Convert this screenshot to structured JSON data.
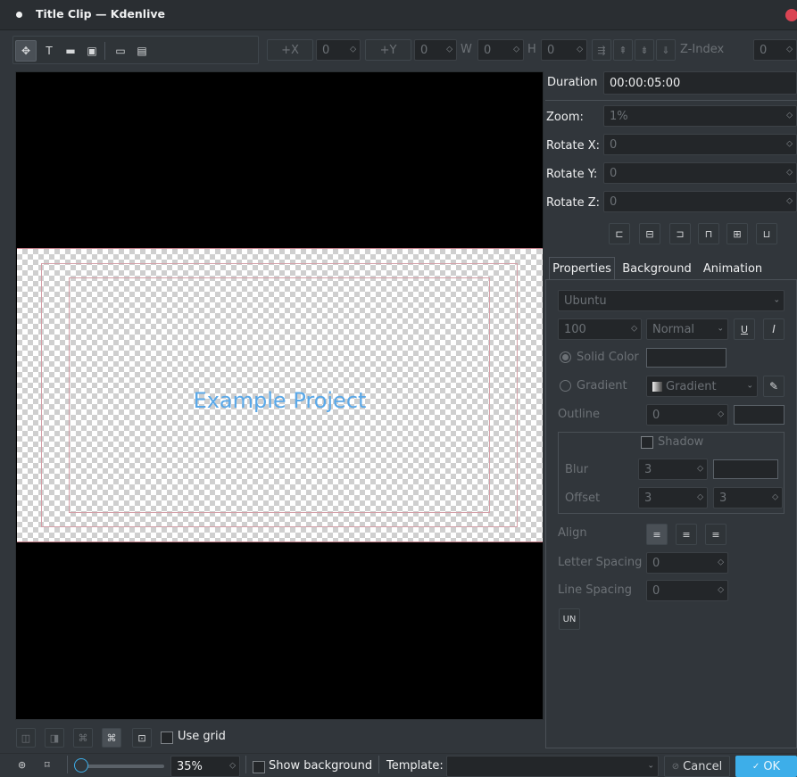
{
  "window": {
    "title": "Title Clip — Kdenlive"
  },
  "toolbar": {
    "tools": [
      "selection-tool",
      "text-tool",
      "rectangle-tool",
      "image-tool",
      "open-document",
      "save-as"
    ],
    "x_label": "+X",
    "x_value": "0",
    "y_label": "+Y",
    "y_value": "0",
    "w_label": "W",
    "w_value": "0",
    "h_label": "H",
    "h_value": "0",
    "zindex_label": "Z-Index",
    "zindex_value": "0"
  },
  "canvas": {
    "sample_text": "Example Project",
    "sample_color": "#5aa8e8"
  },
  "right": {
    "duration_label": "Duration",
    "duration_value": "00:00:05:00",
    "zoom_label": "Zoom:",
    "zoom_value": "1%",
    "rotx_label": "Rotate X:",
    "rotx_value": "0",
    "roty_label": "Rotate Y:",
    "roty_value": "0",
    "rotz_label": "Rotate Z:",
    "rotz_value": "0"
  },
  "tabs": [
    "Properties",
    "Background",
    "Animation"
  ],
  "props": {
    "font": "Ubuntu",
    "font_size": "100",
    "weight": "Normal",
    "underline": "U",
    "italic": "I",
    "solid_color": "Solid Color",
    "gradient_radio": "Gradient",
    "gradient_select": "Gradient",
    "outline_label": "Outline",
    "outline_value": "0",
    "shadow_label": "Shadow",
    "blur_label": "Blur",
    "blur_value": "3",
    "offset_label": "Offset",
    "offset_x": "3",
    "offset_y": "3",
    "align_label": "Align",
    "letter_spacing_label": "Letter Spacing",
    "letter_spacing_value": "0",
    "line_spacing_label": "Line Spacing",
    "line_spacing_value": "0",
    "un_button": "UN"
  },
  "bottombar": {
    "use_grid": "Use grid",
    "zoom_pct": "35%",
    "show_background": "Show background",
    "template_label": "Template:",
    "template_value": "",
    "cancel": "Cancel",
    "ok": "OK"
  },
  "colors": {
    "accent": "#3daee9",
    "bg": "#31363b",
    "close": "#da4453",
    "safe_zone": "#c27b86"
  }
}
